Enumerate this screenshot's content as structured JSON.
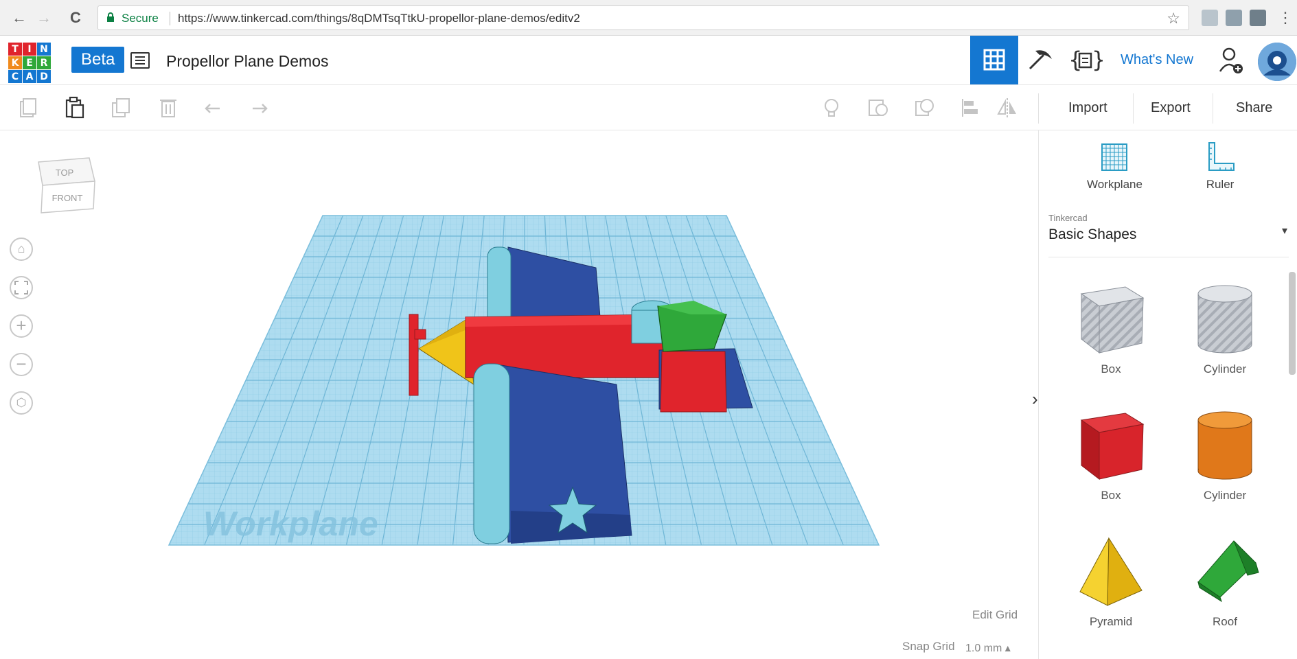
{
  "browser": {
    "secure_label": "Secure",
    "url": "https://www.tinkercad.com/things/8qDMTsqTtkU-propellor-plane-demos/editv2",
    "back_icon": "←",
    "forward_icon": "→",
    "reload_icon": "C",
    "star_icon": "☆",
    "menu_icon": "⋮"
  },
  "app": {
    "logo_letters": [
      "T",
      "I",
      "N",
      "K",
      "E",
      "R",
      "C",
      "A",
      "D"
    ],
    "beta_label": "Beta",
    "design_title": "Propellor Plane Demos",
    "whats_new_label": "What's New"
  },
  "toolbar": {
    "import_label": "Import",
    "export_label": "Export",
    "share_label": "Share"
  },
  "viewcube": {
    "top_label": "TOP",
    "front_label": "FRONT"
  },
  "viewport": {
    "workplane_label": "Workplane",
    "edit_grid_label": "Edit Grid",
    "snap_grid_label": "Snap Grid",
    "snap_grid_value": "1.0 mm ▴"
  },
  "panel": {
    "workplane_label": "Workplane",
    "ruler_label": "Ruler",
    "library_source": "Tinkercad",
    "library_name": "Basic Shapes",
    "shapes": [
      {
        "label": "Box"
      },
      {
        "label": "Cylinder"
      },
      {
        "label": "Box"
      },
      {
        "label": "Cylinder"
      },
      {
        "label": "Pyramid"
      },
      {
        "label": "Roof"
      }
    ]
  },
  "colors": {
    "accent": "#1477d1",
    "plane_red": "#e0242c",
    "plane_blue": "#2e4fa3",
    "plane_yellow": "#f0c419",
    "plane_green": "#2fa83a",
    "plane_teal": "#7fcfe0",
    "workplane": "#a9dcf0"
  }
}
